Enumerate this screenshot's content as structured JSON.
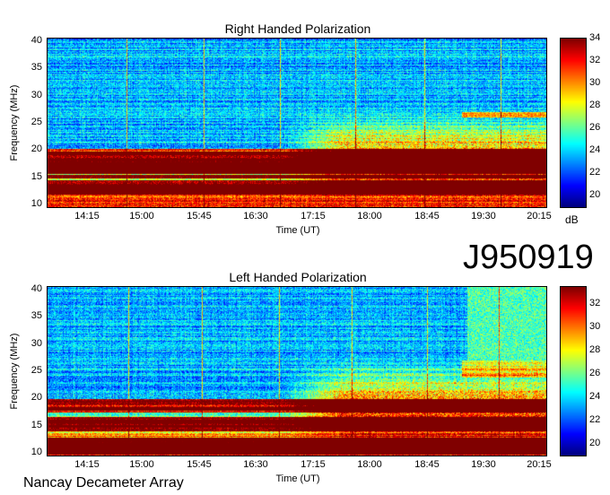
{
  "chart_data": [
    {
      "type": "heatmap",
      "title": "Right Handed Polarization",
      "xlabel": "Time (UT)",
      "ylabel": "Frequency (MHz)",
      "x_ticks": [
        "14:15",
        "15:00",
        "15:45",
        "16:30",
        "17:15",
        "18:00",
        "18:45",
        "19:30",
        "20:15"
      ],
      "y_ticks": [
        "10",
        "15",
        "20",
        "25",
        "30",
        "35",
        "40"
      ],
      "ylim": [
        10,
        40
      ],
      "colorbar": {
        "unit": "dB",
        "ticks": [
          "20",
          "22",
          "24",
          "26",
          "28",
          "30",
          "32",
          "34"
        ],
        "range": [
          19,
          34
        ]
      }
    },
    {
      "type": "heatmap",
      "title": "Left Handed Polarization",
      "xlabel": "Time (UT)",
      "ylabel": "Frequency (MHz)",
      "x_ticks": [
        "14:15",
        "15:00",
        "15:45",
        "16:30",
        "17:15",
        "18:00",
        "18:45",
        "19:30",
        "20:15"
      ],
      "y_ticks": [
        "10",
        "15",
        "20",
        "25",
        "30",
        "35",
        "40"
      ],
      "ylim": [
        10,
        40
      ],
      "colorbar": {
        "unit": "dB",
        "ticks": [
          "20",
          "22",
          "24",
          "26",
          "28",
          "30",
          "32"
        ],
        "range": [
          19,
          33.5
        ]
      }
    }
  ],
  "event_id": "J950919",
  "footer_label": "Nancay Decameter Array"
}
